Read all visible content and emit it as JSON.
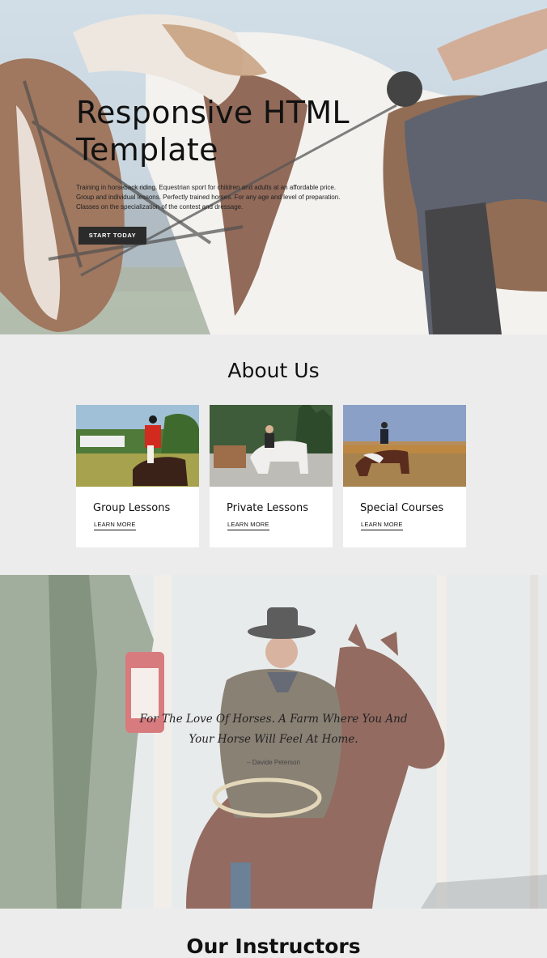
{
  "hero": {
    "title_line1": "Responsive HTML",
    "title_line2": "Template",
    "description": "Training in horseback riding. Equestrian sport for children and adults at an affordable price. Group and individual lessons. Perfectly trained horses. For any age and level of preparation. Classes on the specialization of the contest and dressage.",
    "button_label": "START TODAY"
  },
  "about": {
    "title": "About Us",
    "cards": [
      {
        "title": "Group Lessons",
        "link": "LEARN MORE"
      },
      {
        "title": "Private Lessons",
        "link": "LEARN MORE"
      },
      {
        "title": "Special Courses",
        "link": "LEARN MORE"
      }
    ]
  },
  "quote": {
    "text_line1": "For The Love Of Horses. A Farm Where You And",
    "text_line2": "Your Horse Will Feel At Home.",
    "author": "– Davide Peterson"
  },
  "instructors": {
    "title": "Our Instructors"
  },
  "colors": {
    "page_background": "#ececec",
    "button": "#2b2b2b",
    "card_background": "#ffffff"
  }
}
